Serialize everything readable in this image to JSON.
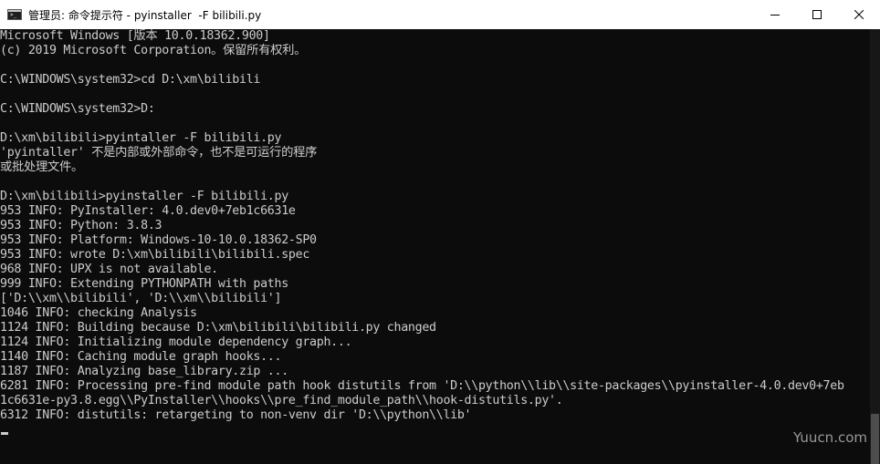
{
  "window": {
    "title": "管理员: 命令提示符 - pyinstaller  -F bilibili.py",
    "app_icon_text": ">_",
    "controls": {
      "minimize_icon": "minimize-icon",
      "maximize_icon": "maximize-icon",
      "close_icon": "close-icon"
    }
  },
  "console": {
    "lines": [
      "Microsoft Windows [版本 10.0.18362.900]",
      "(c) 2019 Microsoft Corporation。保留所有权利。",
      "",
      "C:\\WINDOWS\\system32>cd D:\\xm\\bilibili",
      "",
      "C:\\WINDOWS\\system32>D:",
      "",
      "D:\\xm\\bilibili>pyintaller -F bilibili.py",
      "'pyintaller' 不是内部或外部命令，也不是可运行的程序",
      "或批处理文件。",
      "",
      "D:\\xm\\bilibili>pyinstaller -F bilibili.py",
      "953 INFO: PyInstaller: 4.0.dev0+7eb1c6631e",
      "953 INFO: Python: 3.8.3",
      "953 INFO: Platform: Windows-10-10.0.18362-SP0",
      "953 INFO: wrote D:\\xm\\bilibili\\bilibili.spec",
      "968 INFO: UPX is not available.",
      "999 INFO: Extending PYTHONPATH with paths",
      "['D:\\\\xm\\\\bilibili', 'D:\\\\xm\\\\bilibili']",
      "1046 INFO: checking Analysis",
      "1124 INFO: Building because D:\\xm\\bilibili\\bilibili.py changed",
      "1124 INFO: Initializing module dependency graph...",
      "1140 INFO: Caching module graph hooks...",
      "1187 INFO: Analyzing base_library.zip ...",
      "6281 INFO: Processing pre-find module path hook distutils from 'D:\\\\python\\\\lib\\\\site-packages\\\\pyinstaller-4.0.dev0+7eb",
      "1c6631e-py3.8.egg\\\\PyInstaller\\\\hooks\\\\pre_find_module_path\\\\hook-distutils.py'.",
      "6312 INFO: distutils: retargeting to non-venv dir 'D:\\\\python\\\\lib'"
    ]
  },
  "watermark": {
    "text": "Yuucn.com"
  },
  "colors": {
    "console_bg": "#0c0c0c",
    "console_text": "#cccccc",
    "titlebar_bg": "#ffffff"
  }
}
